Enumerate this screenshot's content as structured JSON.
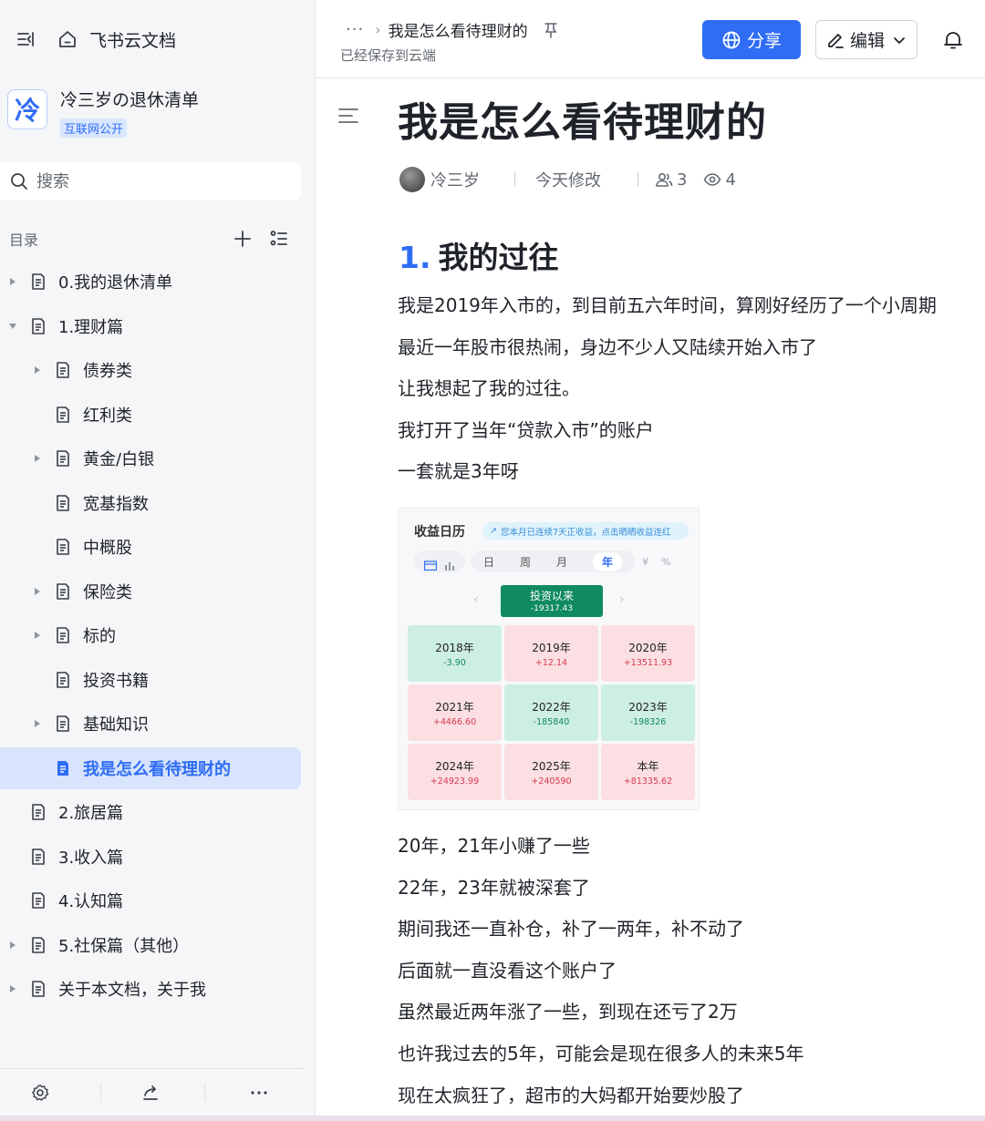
{
  "sidebar": {
    "app_name": "飞书云文档",
    "space_title": "冷三岁の退休清单",
    "space_logo": "冷",
    "space_badge": "互联网公开",
    "search_placeholder": "搜索",
    "toc_label": "目录",
    "tree": [
      {
        "label": "0.我的退休清单",
        "level": 0,
        "expandable": true,
        "expanded": false
      },
      {
        "label": "1.理财篇",
        "level": 0,
        "expandable": true,
        "expanded": true
      },
      {
        "label": "债券类",
        "level": 1,
        "expandable": true,
        "expanded": false
      },
      {
        "label": "红利类",
        "level": 1,
        "expandable": false
      },
      {
        "label": "黄金/白银",
        "level": 1,
        "expandable": true,
        "expanded": false
      },
      {
        "label": "宽基指数",
        "level": 1,
        "expandable": false
      },
      {
        "label": "中概股",
        "level": 1,
        "expandable": false
      },
      {
        "label": "保险类",
        "level": 1,
        "expandable": true,
        "expanded": false
      },
      {
        "label": "标的",
        "level": 1,
        "expandable": true,
        "expanded": false
      },
      {
        "label": "投资书籍",
        "level": 1,
        "expandable": false
      },
      {
        "label": "基础知识",
        "level": 1,
        "expandable": true,
        "expanded": false
      },
      {
        "label": "我是怎么看待理财的",
        "level": 1,
        "expandable": false,
        "active": true
      },
      {
        "label": "2.旅居篇",
        "level": 0,
        "expandable": false
      },
      {
        "label": "3.收入篇",
        "level": 0,
        "expandable": false
      },
      {
        "label": "4.认知篇",
        "level": 0,
        "expandable": false
      },
      {
        "label": "5.社保篇（其他）",
        "level": 0,
        "expandable": true,
        "expanded": false
      },
      {
        "label": "关于本文档，关于我",
        "level": 0,
        "expandable": true,
        "expanded": false
      }
    ]
  },
  "header": {
    "more": "···",
    "breadcrumb_current": "我是怎么看待理财的",
    "saved_status": "已经保存到云端",
    "share_label": "分享",
    "edit_label": "编辑"
  },
  "doc": {
    "title": "我是怎么看待理财的",
    "author": "冷三岁",
    "modified": "今天修改",
    "collaborators": "3",
    "views": "4",
    "section_number": "1.",
    "section_title": "我的过往",
    "paragraphs_top": [
      "我是2019年入市的，到目前五六年时间，算刚好经历了一个小周期",
      "最近一年股市很热闹，身边不少人又陆续开始入市了",
      "让我想起了我的过往。",
      "我打开了当年“贷款入市”的账户",
      "一套就是3年呀"
    ],
    "paragraphs_bottom": [
      "20年，21年小赚了一些",
      "22年，23年就被深套了",
      "期间我还一直补仓，补了一两年，补不动了",
      "后面就一直没看这个账户了",
      "虽然最近两年涨了一些，到现在还亏了2万",
      "也许我过去的5年，可能会是现在很多人的未来5年",
      "现在太疯狂了，超市的大妈都开始要炒股了"
    ]
  },
  "embedded_screenshot": {
    "title": "收益日历",
    "tip": "您本月已连续7天正收益，点击晒晒收益连红",
    "tabs": [
      "日",
      "周",
      "月",
      "年"
    ],
    "active_tab": "年",
    "toggles": [
      "¥",
      "%"
    ],
    "summary_label": "投资以来",
    "summary_value": "-19317.43",
    "cells": [
      {
        "year": "2018年",
        "value": "-3.90",
        "tone": "gain-green"
      },
      {
        "year": "2019年",
        "value": "+12.14",
        "tone": "loss-red"
      },
      {
        "year": "2020年",
        "value": "+13511.93",
        "tone": "loss-red"
      },
      {
        "year": "2021年",
        "value": "+4466.60",
        "tone": "loss-red"
      },
      {
        "year": "2022年",
        "value": "-185840",
        "tone": "gain-green"
      },
      {
        "year": "2023年",
        "value": "-198326",
        "tone": "gain-green"
      },
      {
        "year": "2024年",
        "value": "+24923.99",
        "tone": "loss-red"
      },
      {
        "year": "2025年",
        "value": "+240590",
        "tone": "loss-red"
      },
      {
        "year": "本年",
        "value": "+81335.62",
        "tone": "loss-red"
      }
    ]
  },
  "colors": {
    "accent": "#2f6df5",
    "sidebar_bg": "#f5f6f7",
    "active_bg": "#d8e4fc",
    "green": "#11895f",
    "red": "#d83a52"
  }
}
